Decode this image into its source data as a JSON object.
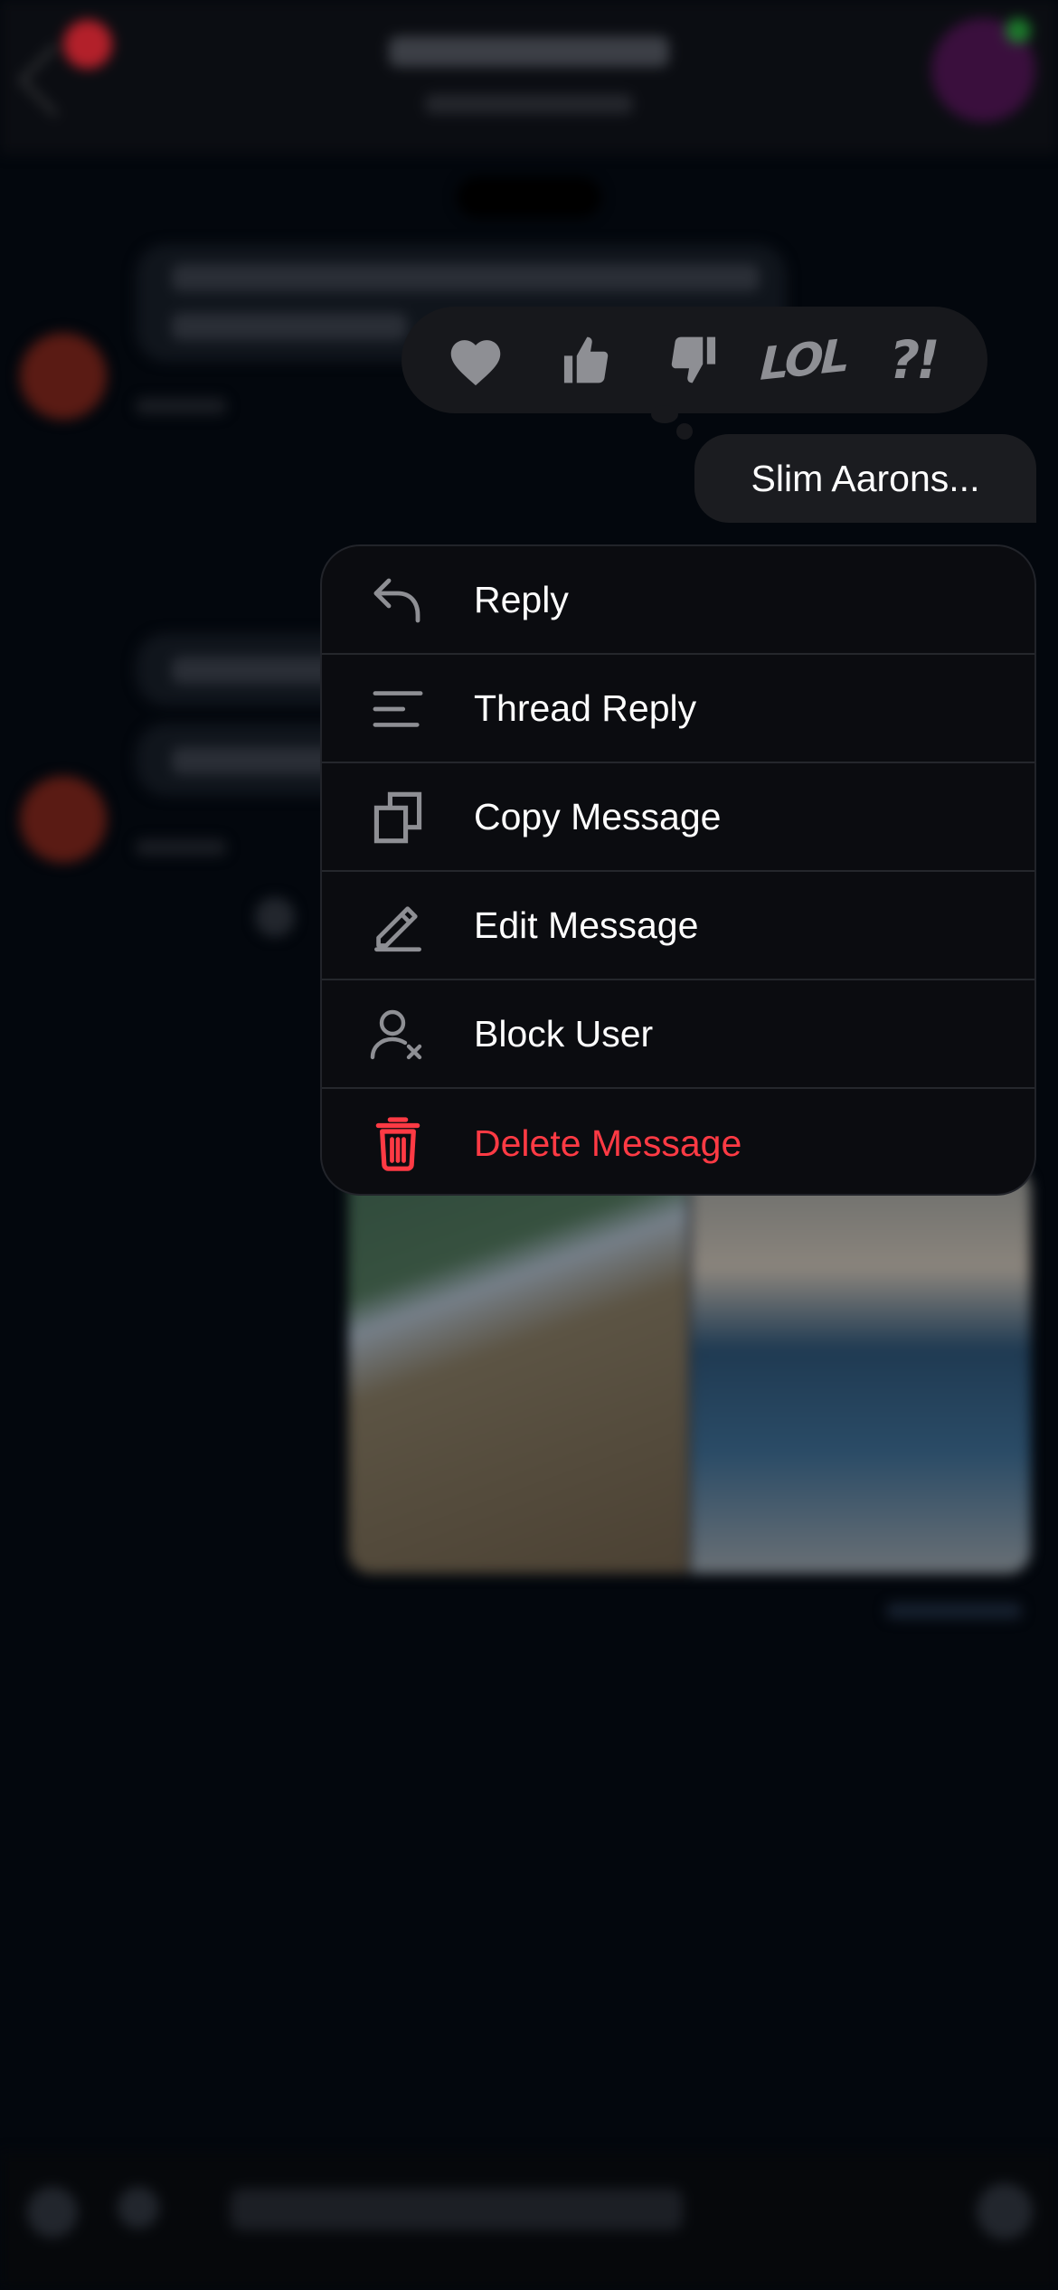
{
  "reactions": [
    {
      "name": "heart",
      "label": ""
    },
    {
      "name": "thumbs-up",
      "label": ""
    },
    {
      "name": "thumbs-down",
      "label": ""
    },
    {
      "name": "lol",
      "label": "LOL"
    },
    {
      "name": "question-exclamation",
      "label": "?!"
    }
  ],
  "selected_message": {
    "text": "Slim Aarons..."
  },
  "menu": {
    "items": [
      {
        "label": "Reply",
        "icon": "reply-arrow-icon"
      },
      {
        "label": "Thread Reply",
        "icon": "thread-lines-icon"
      },
      {
        "label": "Copy Message",
        "icon": "copy-icon"
      },
      {
        "label": "Edit Message",
        "icon": "pencil-icon"
      },
      {
        "label": "Block User",
        "icon": "block-user-icon"
      },
      {
        "label": "Delete Message",
        "icon": "trash-icon"
      }
    ]
  },
  "colors": {
    "background": "#03070d",
    "menu_background": "#0b0c10",
    "reaction_bar": "#17181c",
    "icon_gray": "#8e8f94",
    "danger_red": "#ff3a44"
  }
}
